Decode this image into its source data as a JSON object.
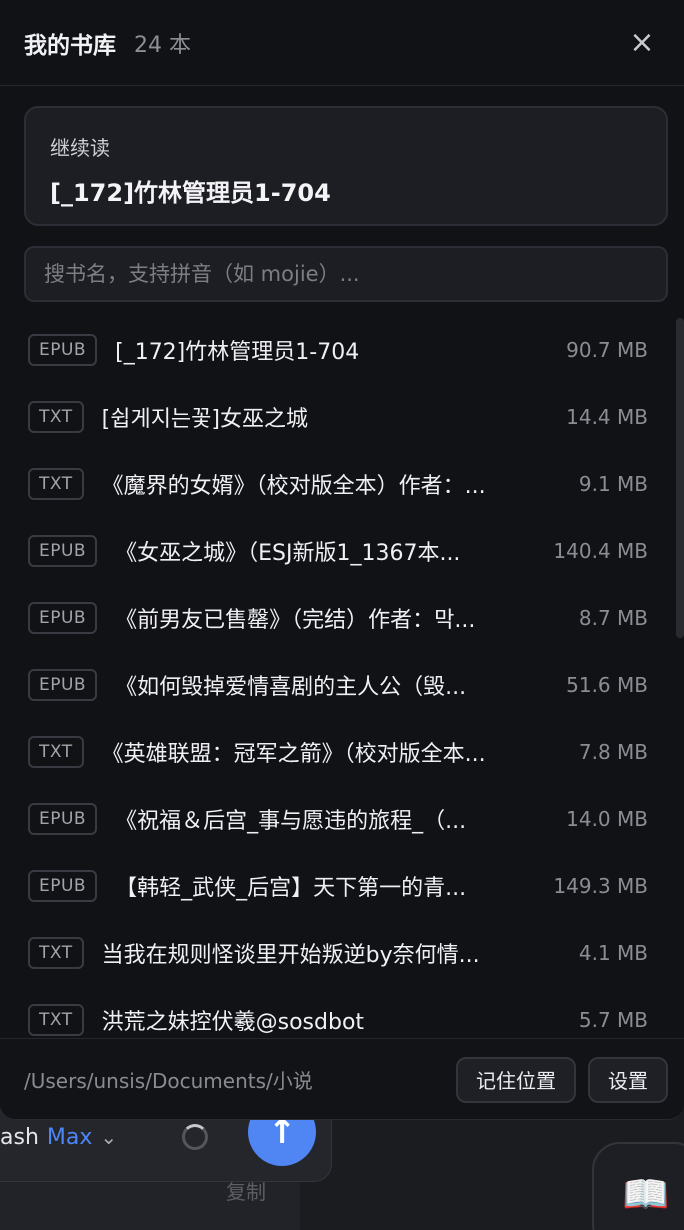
{
  "header": {
    "title": "我的书库",
    "count": "24 本",
    "close_label": "×"
  },
  "continue_reading": {
    "label": "继续读",
    "book": "[_172]竹林管理员1-704"
  },
  "search": {
    "placeholder": "搜书名，支持拼音（如 mojie）..."
  },
  "books": [
    {
      "format": "EPUB",
      "name": "[_172]竹林管理员1-704",
      "size": "90.7 MB"
    },
    {
      "format": "TXT",
      "name": "[쉽게지는꽃]女巫之城",
      "size": "14.4 MB"
    },
    {
      "format": "TXT",
      "name": "《魔界的女婿》（校对版全本）作者：...",
      "size": "9.1 MB"
    },
    {
      "format": "EPUB",
      "name": "《女巫之城》（ESJ新版1_1367本...",
      "size": "140.4 MB"
    },
    {
      "format": "EPUB",
      "name": "《前男友已售罄》（完结）作者：막...",
      "size": "8.7 MB"
    },
    {
      "format": "EPUB",
      "name": "《如何毁掉爱情喜剧的主人公（毁...",
      "size": "51.6 MB"
    },
    {
      "format": "TXT",
      "name": "《英雄联盟：冠军之箭》（校对版全本...",
      "size": "7.8 MB"
    },
    {
      "format": "EPUB",
      "name": "《祝福＆后宫_事与愿违的旅程_（...",
      "size": "14.0 MB"
    },
    {
      "format": "EPUB",
      "name": "【韩轻_武侠_后宫】天下第一的青...",
      "size": "149.3 MB"
    },
    {
      "format": "TXT",
      "name": "当我在规则怪谈里开始叛逆by奈何情...",
      "size": "4.1 MB"
    },
    {
      "format": "TXT",
      "name": "洪荒之妹控伏羲@sosdbot",
      "size": "5.7 MB"
    }
  ],
  "footer": {
    "path": "/Users/unsis/Documents/小说",
    "remember_label": "记住位置",
    "settings_label": "设置"
  },
  "background": {
    "model_name": "ash",
    "model_tier": "Max",
    "copy_label": "复制",
    "send_icon": "arrow-up-icon",
    "book_icon": "open-book-icon"
  },
  "colors": {
    "accent": "#4f86f3",
    "panel_bg": "#111216",
    "card_bg": "#1d1e23"
  }
}
